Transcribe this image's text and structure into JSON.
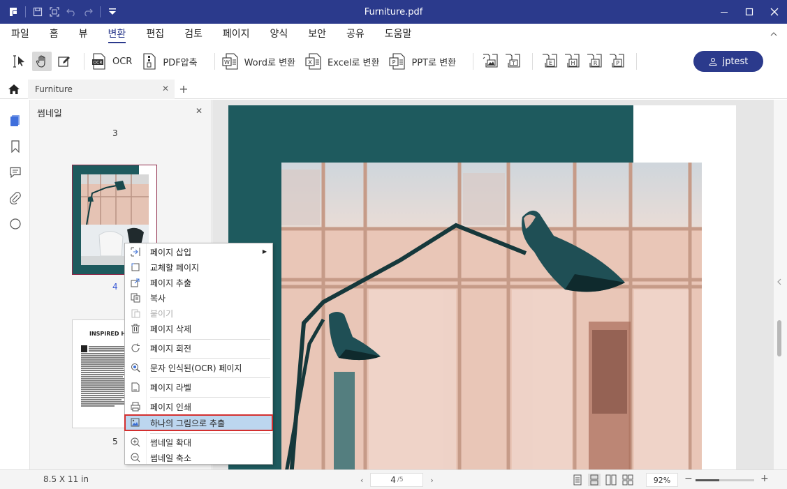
{
  "window": {
    "title": "Furniture.pdf",
    "controls": [
      "minimize",
      "maximize",
      "close"
    ]
  },
  "menubar": {
    "items": [
      "파일",
      "홈",
      "뷰",
      "변환",
      "편집",
      "검토",
      "페이지",
      "양식",
      "보안",
      "공유",
      "도움말"
    ],
    "active": "변환"
  },
  "toolbar": {
    "ocr_label": "OCR",
    "compress_label": "PDF압축",
    "to_word_label": "Word로 변환",
    "to_excel_label": "Excel로 변환",
    "to_ppt_label": "PPT로 변환",
    "icon_letters": [
      "E",
      "H",
      "R",
      "P"
    ],
    "user_label": "jptest"
  },
  "tabs": {
    "doc_tab_label": "Furniture"
  },
  "thumbnails": {
    "panel_title": "썸네일",
    "page_numbers": [
      "3",
      "4",
      "5"
    ],
    "page5_heading": "INSPIRED H"
  },
  "context_menu": {
    "items": [
      {
        "label": "페이지 삽입",
        "icon": "insert-page-icon",
        "submenu": true
      },
      {
        "label": "교체할 페이지",
        "icon": "replace-page-icon"
      },
      {
        "label": "페이지 추출",
        "icon": "extract-page-icon"
      },
      {
        "label": "복사",
        "icon": "copy-icon"
      },
      {
        "label": "붙이기",
        "icon": "paste-icon",
        "disabled": true
      },
      {
        "label": "페이지 삭제",
        "icon": "trash-icon"
      },
      {
        "label": "페이지 회전",
        "icon": "rotate-icon"
      },
      {
        "label": "문자 인식된(OCR) 페이지",
        "icon": "ocr-search-icon"
      },
      {
        "label": "페이지 라벨",
        "icon": "page-label-icon"
      },
      {
        "label": "페이지 인쇄",
        "icon": "print-icon"
      },
      {
        "label": "하나의 그림으로 추출",
        "icon": "image-extract-icon",
        "highlighted": true
      },
      {
        "label": "썸네일 확대",
        "icon": "zoom-in-icon"
      },
      {
        "label": "썸네일 축소",
        "icon": "zoom-out-icon"
      }
    ]
  },
  "statusbar": {
    "page_size": "8.5 X 11 in",
    "current_page": "4",
    "total_pages": "/5",
    "zoom": "92%",
    "zoom_fraction": 0.4
  },
  "colors": {
    "brand": "#2b3a8c",
    "teal": "#1e5a5e",
    "highlight": "#bcd6ef",
    "highlight_border": "#d32f2f"
  }
}
